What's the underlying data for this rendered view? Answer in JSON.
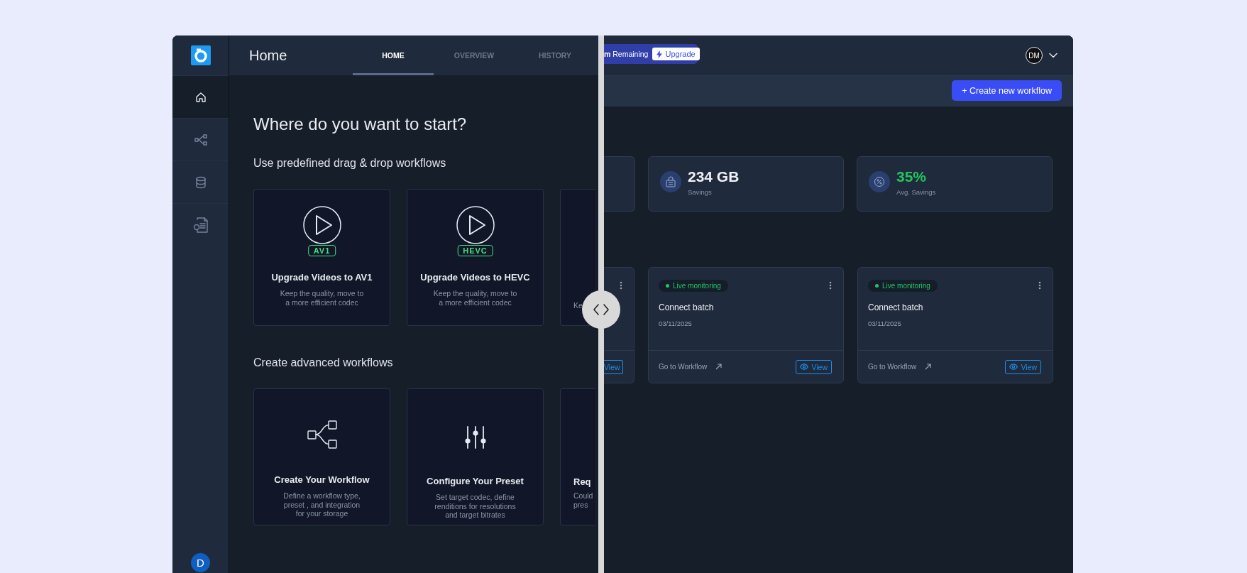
{
  "sidebar": {
    "items": [
      {
        "kind": "home",
        "selected": true
      },
      {
        "kind": "workflow",
        "selected": false
      },
      {
        "kind": "database",
        "selected": false
      },
      {
        "kind": "billing",
        "selected": false
      }
    ],
    "avatar": "D"
  },
  "left_view": {
    "title": "Home",
    "tabs": [
      {
        "label": "HOME",
        "selected": true
      },
      {
        "label": "OVERVIEW",
        "selected": false
      },
      {
        "label": "HISTORY",
        "selected": false
      }
    ],
    "heading": "Where do you want to start?",
    "sections": [
      {
        "title": "Use predefined  drag & drop workflows",
        "cards": [
          {
            "kind": "codec",
            "badge": "AV1",
            "title": "Upgrade Videos to AV1",
            "description": "Keep the quality, move to\na more efficient codec"
          },
          {
            "kind": "codec",
            "badge": "HEVC",
            "title": "Upgrade Videos to HEVC",
            "description": "Keep the quality, move to\na more efficient codec"
          },
          {
            "kind": "partial",
            "description": "Ke"
          }
        ]
      },
      {
        "title": "Create advanced workflows",
        "cards": [
          {
            "kind": "workflow",
            "title": "Create Your Workflow",
            "description": "Define a workflow type,\npreset , and integration\nfor your storage"
          },
          {
            "kind": "preset",
            "title": "Configure Your Preset",
            "description": "Set target codec, define\nrenditions for resolutions\nand target bitrates"
          },
          {
            "kind": "partial",
            "title": "Req",
            "description": "Could\npres"
          }
        ]
      }
    ]
  },
  "right_view": {
    "usage": {
      "text": "**m** Remaining",
      "button": "Upgrade"
    },
    "user": {
      "initials": "DM"
    },
    "create_button": "+ Create new workflow",
    "stats": [
      {
        "kind": "partial"
      },
      {
        "kind": "storage",
        "value": "234 GB",
        "label": "Savings",
        "color": "#eef0f4"
      },
      {
        "kind": "percent",
        "value": "35%",
        "label": "Avg. Savings",
        "color": "#22c55e"
      }
    ],
    "workflows": [
      {
        "kind": "partial",
        "button": "View"
      },
      {
        "kind": "full",
        "status": "Live monitoring",
        "title": "Connect batch",
        "date": "03/11/2025",
        "link": "Go to Workflow",
        "button": "View"
      },
      {
        "kind": "full",
        "status": "Live monitoring",
        "title": "Connect batch",
        "date": "03/11/2025",
        "link": "Go to Workflow",
        "button": "View"
      }
    ]
  }
}
